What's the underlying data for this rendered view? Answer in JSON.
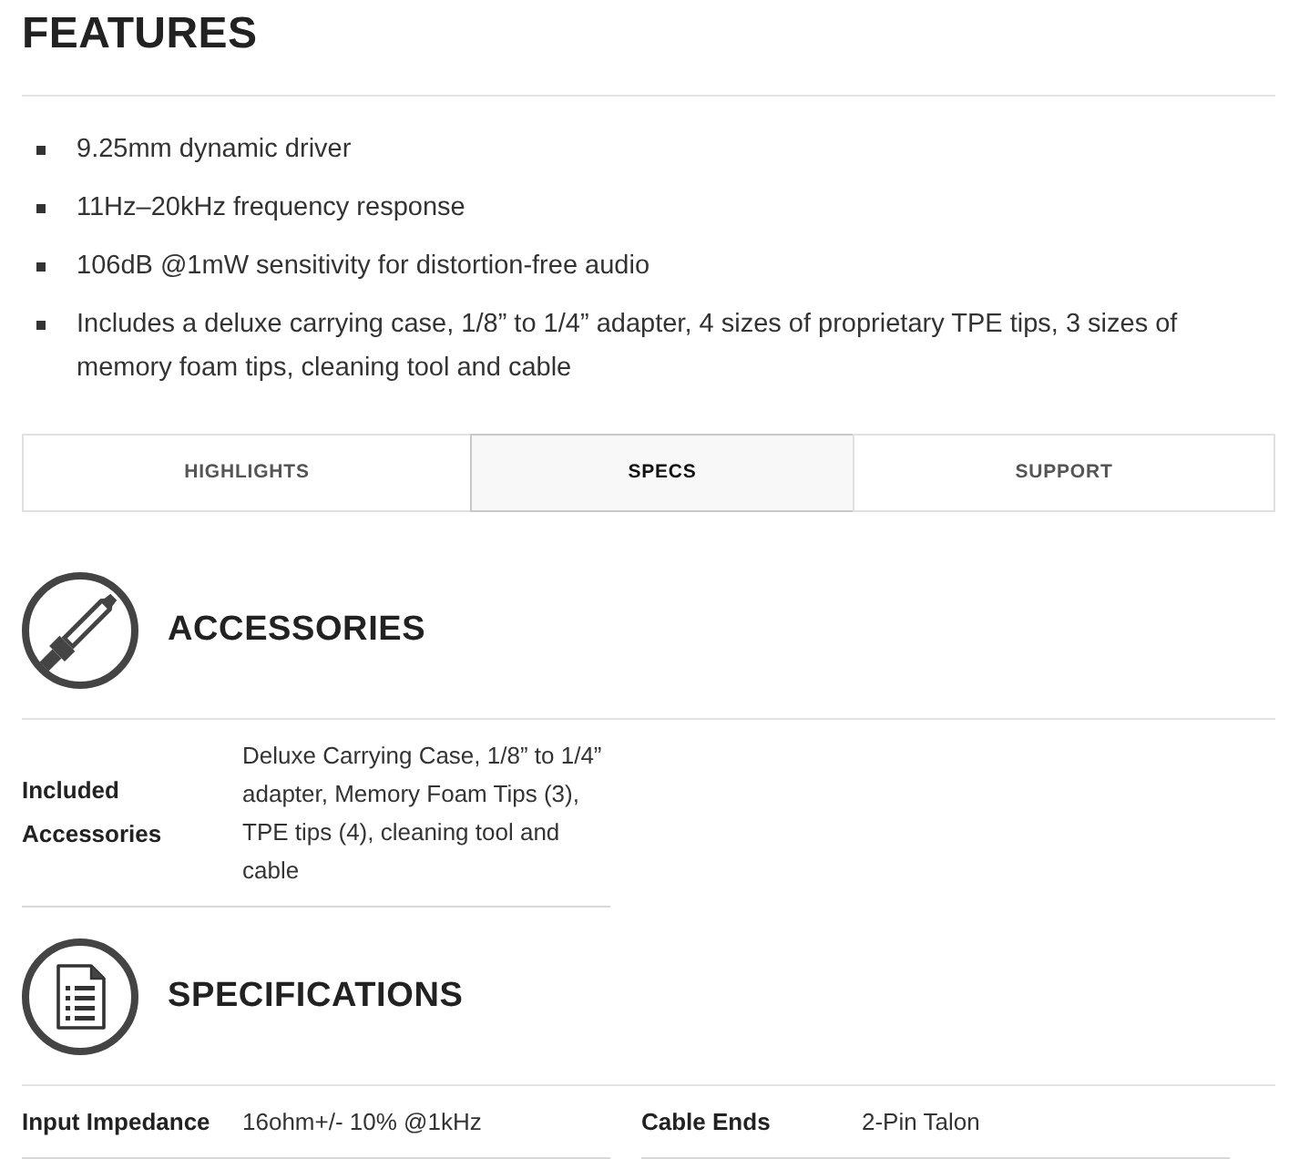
{
  "features": {
    "title": "FEATURES",
    "items": [
      "9.25mm dynamic driver",
      "11Hz–20kHz frequency response",
      "106dB @1mW sensitivity for distortion-free audio",
      "Includes a deluxe carrying case, 1/8” to 1/4” adapter, 4 sizes of proprietary TPE tips, 3 sizes of memory foam tips, cleaning tool and cable"
    ]
  },
  "tabs": [
    {
      "label": "HIGHLIGHTS",
      "selected": false
    },
    {
      "label": "SPECS",
      "selected": true
    },
    {
      "label": "SUPPORT",
      "selected": false
    }
  ],
  "sections": [
    {
      "kind": "accessories",
      "title": "ACCESSORIES",
      "rows": [
        [
          {
            "label": "Included Accessories",
            "value": "Deluxe Carrying Case, 1/8” to 1/4” adapter, Memory Foam Tips (3), TPE tips (4), cleaning tool and cable"
          }
        ]
      ]
    },
    {
      "kind": "specifications",
      "title": "SPECIFICATIONS",
      "rows": [
        [
          {
            "label": "Input Impedance",
            "value": "16ohm+/- 10% @1kHz"
          },
          {
            "label": "Cable Ends",
            "value": "2-Pin Talon"
          }
        ]
      ]
    }
  ]
}
